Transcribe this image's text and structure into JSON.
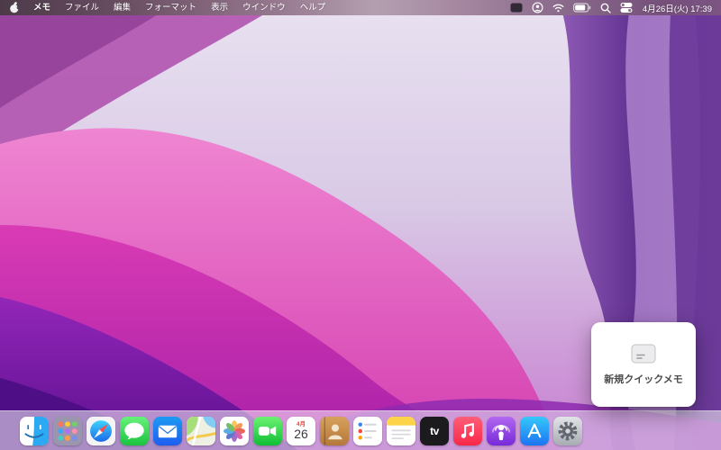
{
  "menu_bar": {
    "app_name": "メモ",
    "items": [
      "ファイル",
      "編集",
      "フォーマット",
      "表示",
      "ウインドウ",
      "ヘルプ"
    ],
    "status_icons": [
      "keyboard-icon",
      "user-icon",
      "wifi-icon",
      "battery-icon",
      "spotlight-icon",
      "control-center-icon"
    ],
    "datetime": "4月26日(火) 17:39"
  },
  "dock": {
    "items": [
      "finder",
      "launchpad",
      "safari",
      "messages",
      "mail",
      "maps",
      "photos",
      "facetime",
      "calendar",
      "contacts",
      "reminders",
      "notes",
      "tv",
      "music",
      "podcasts",
      "app-store",
      "system-preferences"
    ],
    "calendar": {
      "month": "4月",
      "day": "26"
    },
    "tv_label": "tv"
  },
  "quick_note": {
    "label": "新規クイックメモ"
  },
  "colors": {
    "wallpaper_pink": "#d43fb0",
    "wallpaper_deep_purple": "#5c1090",
    "menubar_text": "#ffffff"
  }
}
